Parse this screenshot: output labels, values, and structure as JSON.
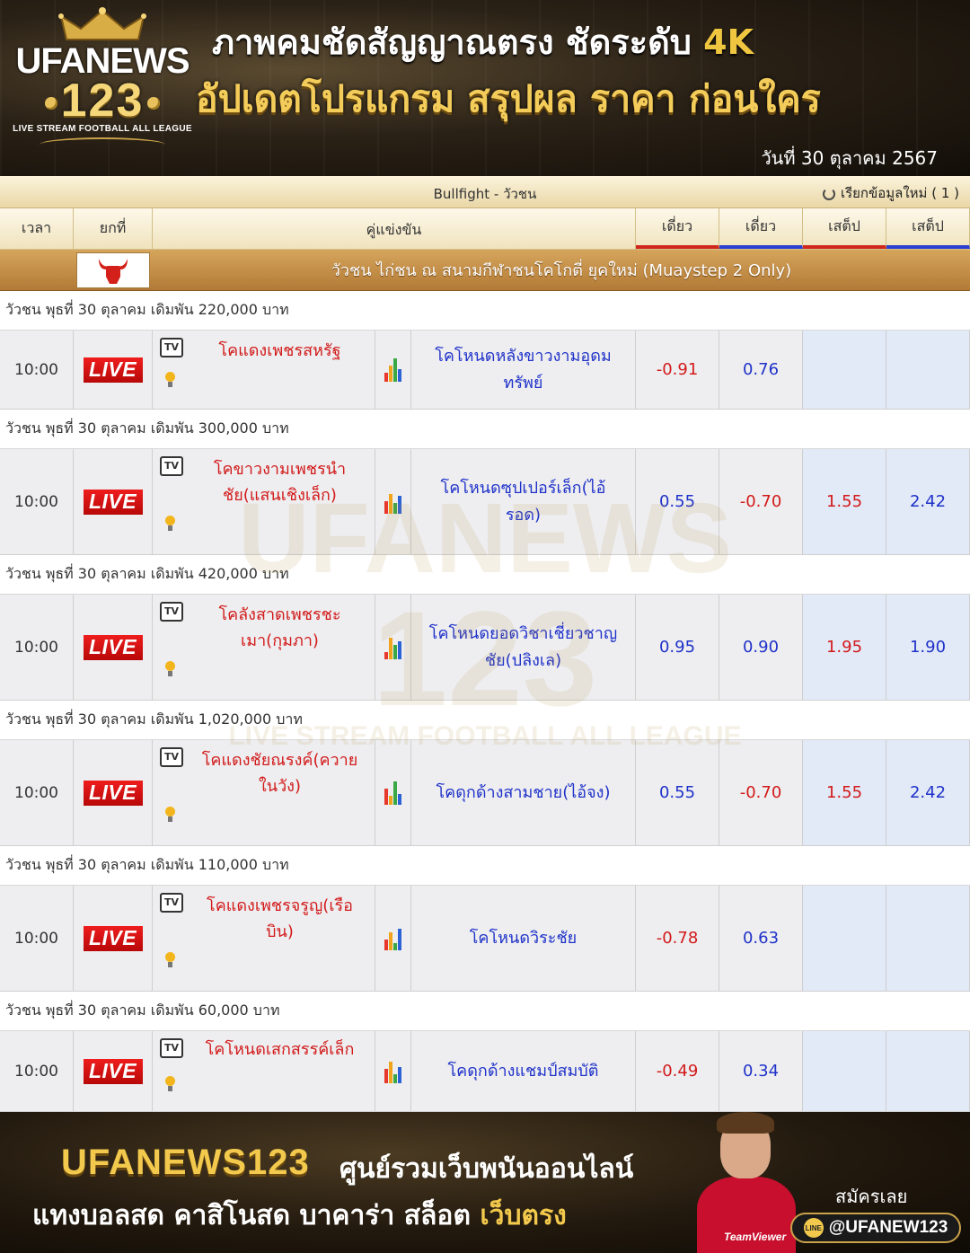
{
  "header": {
    "logo": {
      "brand_top": "UFANEWS",
      "brand_num": "123",
      "tagline": "LIVE STREAM FOOTBALL ALL LEAGUE"
    },
    "headline1_text": "ภาพคมชัดสัญญาณตรง ชัดระดับ ",
    "headline1_highlight": "4K",
    "headline2": "อัปเดตโปรแกรม สรุปผล ราคา ก่อนใคร",
    "date": "วันที่  30 ตุลาคม 2567"
  },
  "board": {
    "sport_title": "Bullfight - วัวชน",
    "refresh_label": "เรียกข้อมูลใหม่ ( 1 )",
    "columns": {
      "time": "เวลา",
      "round": "ยกที่",
      "match": "คู่แข่งขัน",
      "odds1": "เดี่ยว",
      "odds2": "เดี่ยว",
      "odds3": "เสต็ป",
      "odds4": "เสต็ป"
    },
    "league_title": "วัวชน ไก่ชน ณ สนามกีฬาชนโคโกตี่ ยุคใหม่ (Muaystep 2 Only)",
    "live_label": "LIVE",
    "tv_label": "TV",
    "groups": [
      {
        "title": "วัวชน พุธที่ 30 ตุลาคม เดิมพัน 220,000 บาท",
        "time": "10:00",
        "home": "โคแดงเพชรสหรัฐ",
        "away": "โคโหนดหลังขาวงามอุดมทรัพย์",
        "o1": "-0.91",
        "o2": "0.76",
        "o3": "",
        "o4": ""
      },
      {
        "title": "วัวชน พุธที่ 30 ตุลาคม เดิมพัน 300,000 บาท",
        "time": "10:00",
        "home": "โคขาวงามเพชรนำชัย(แสนเชิงเล็ก)",
        "away": "โคโหนดซุปเปอร์เล็ก(ไอ้รอด)",
        "o1": "0.55",
        "o2": "-0.70",
        "o3": "1.55",
        "o4": "2.42"
      },
      {
        "title": "วัวชน พุธที่ 30 ตุลาคม เดิมพัน 420,000 บาท",
        "time": "10:00",
        "home": "โคลังสาดเพชรชะเมา(กุมภา)",
        "away": "โคโหนดยอดวิชาเชี่ยวชาญชัย(ปลิงเล)",
        "o1": "0.95",
        "o2": "0.90",
        "o3": "1.95",
        "o4": "1.90"
      },
      {
        "title": "วัวชน พุธที่ 30 ตุลาคม เดิมพัน 1,020,000 บาท",
        "time": "10:00",
        "home": "โคแดงชัยณรงค์(ควายในวัง)",
        "away": "โคดุกด้างสามชาย(ไอ้จง)",
        "o1": "0.55",
        "o2": "-0.70",
        "o3": "1.55",
        "o4": "2.42"
      },
      {
        "title": "วัวชน พุธที่ 30 ตุลาคม เดิมพัน 110,000 บาท",
        "time": "10:00",
        "home": "โคแดงเพชรจรูญ(เรือบิน)",
        "away": "โคโหนดวิระชัย",
        "o1": "-0.78",
        "o2": "0.63",
        "o3": "",
        "o4": ""
      },
      {
        "title": "วัวชน พุธที่ 30 ตุลาคม เดิมพัน 60,000 บาท",
        "time": "10:00",
        "home": "โคโหนดเสกสรรค์เล็ก",
        "away": "โคดุกด้างแชมป์สมบัติ",
        "o1": "-0.49",
        "o2": "0.34",
        "o3": "",
        "o4": ""
      }
    ]
  },
  "watermark": {
    "line1": "UFANEWS",
    "line2": "123",
    "line3": "LIVE STREAM FOOTBALL ALL LEAGUE"
  },
  "footer": {
    "brand": "UFANEWS123",
    "brand_sub": "ศูนย์รวมเว็บพนันออนไลน์",
    "line2_text": "แทงบอลสด คาสิโนสด บาคาร่า สล็อต ",
    "line2_highlight": "เว็บตรง",
    "signup": "สมัครเลย",
    "line_id": "@UFANEW123",
    "line_icon_label": "LINE",
    "shirt_text": "TeamViewer"
  },
  "colors": {
    "negative": "#d21a1a",
    "positive": "#1f32c9",
    "gold": "#f2c94c",
    "live_red": "#e01414",
    "league_bar": "#c38a44"
  },
  "icons": [
    "crown-icon",
    "refresh-icon",
    "bull-icon",
    "tv-icon",
    "tips-bulb-icon",
    "stats-bar-icon",
    "line-icon"
  ]
}
